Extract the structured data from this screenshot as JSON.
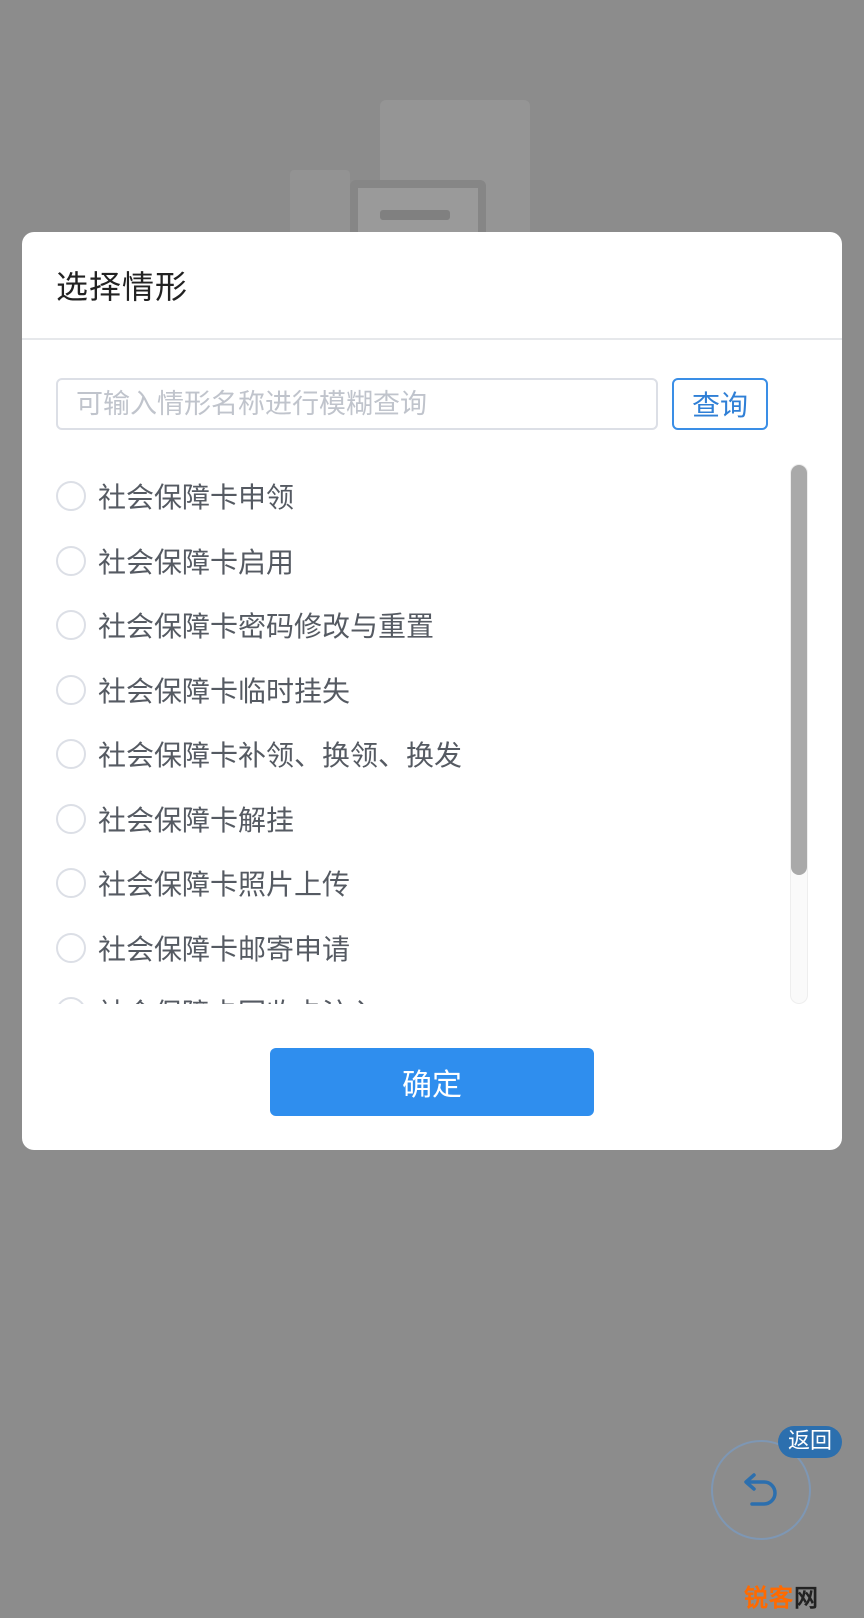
{
  "modal": {
    "title": "选择情形",
    "search": {
      "placeholder": "可输入情形名称进行模糊查询",
      "value": "",
      "button_label": "查询"
    },
    "options": [
      {
        "label": "社会保障卡申领"
      },
      {
        "label": "社会保障卡启用"
      },
      {
        "label": "社会保障卡密码修改与重置"
      },
      {
        "label": "社会保障卡临时挂失"
      },
      {
        "label": "社会保障卡补领、换领、换发"
      },
      {
        "label": "社会保障卡解挂"
      },
      {
        "label": "社会保障卡照片上传"
      },
      {
        "label": "社会保障卡邮寄申请"
      },
      {
        "label": "社会保障卡回收卡注入"
      }
    ],
    "confirm_label": "确定"
  },
  "back": {
    "badge_label": "返回",
    "icon": "undo-arrow-icon"
  },
  "watermark": {
    "brand": "锐客",
    "suffix": "网"
  },
  "colors": {
    "overlay": "#8c8c8c",
    "primary": "#2f8eee",
    "accent_text": "#2f7fd6",
    "badge": "#2c6fae",
    "watermark": "#ff6a00"
  }
}
